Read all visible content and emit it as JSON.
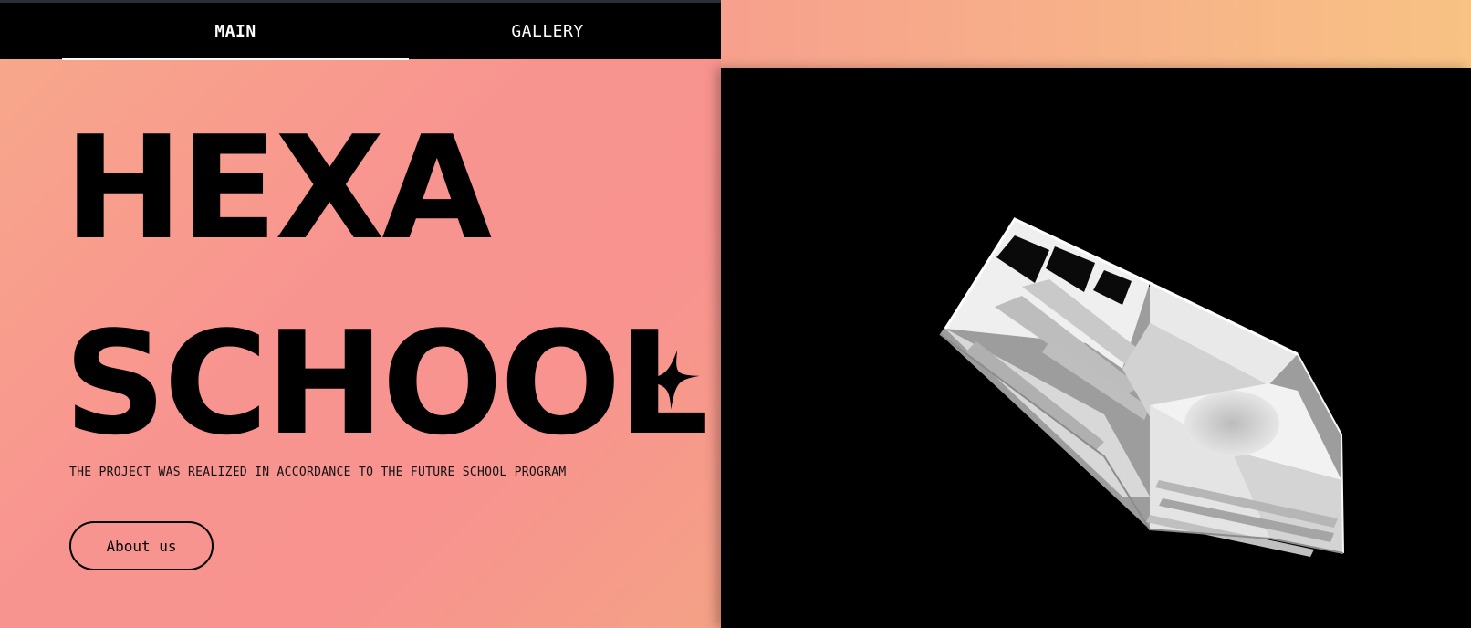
{
  "nav": {
    "tabs": [
      {
        "label": "MAIN",
        "active": true
      },
      {
        "label": "GALLERY",
        "active": false
      }
    ]
  },
  "hero": {
    "line1": "HEXA",
    "line2": "SCHOOL",
    "tagline": "THE PROJECT WAS REALIZED IN ACCORDANCE TO THE FUTURE SCHOOL PROGRAM",
    "cta_label": "About us"
  },
  "icons": {
    "sparkle": "four-point-star-icon"
  },
  "colors": {
    "gradient_start": "#f7a98a",
    "gradient_mid": "#f89490",
    "strip_end": "#f8c284",
    "text": "#000000",
    "viewer_bg": "#000000"
  }
}
